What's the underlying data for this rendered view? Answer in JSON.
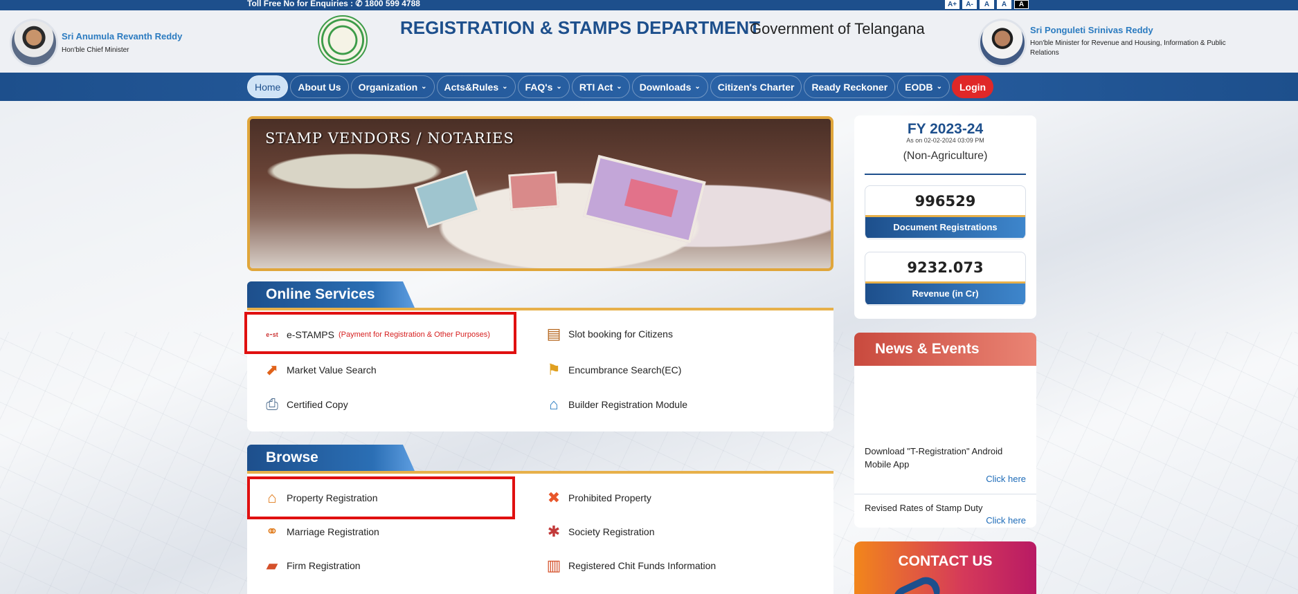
{
  "topbar": {
    "toll_free": "Toll Free No for Enquiries :  ✆ 1800 599 4788",
    "font_buttons": [
      "A+",
      "A-",
      "A",
      "A",
      "A"
    ]
  },
  "header": {
    "chief_minister": {
      "name": "Sri Anumula Revanth Reddy",
      "role": "Hon'ble Chief Minister"
    },
    "department": "REGISTRATION & STAMPS DEPARTMENT",
    "government": "Government of Telangana",
    "minister": {
      "name": "Sri Ponguleti Srinivas Reddy",
      "role": "Hon'ble Minister for Revenue and Housing, Information & Public Relations"
    }
  },
  "nav": {
    "items": [
      {
        "label": "Home",
        "caret": false
      },
      {
        "label": "About Us",
        "caret": false
      },
      {
        "label": "Organization",
        "caret": true
      },
      {
        "label": "Acts&Rules",
        "caret": true
      },
      {
        "label": "FAQ's",
        "caret": true
      },
      {
        "label": "RTI Act",
        "caret": true
      },
      {
        "label": "Downloads",
        "caret": true
      },
      {
        "label": "Citizen's Charter",
        "caret": false
      },
      {
        "label": "Ready Reckoner",
        "caret": false
      },
      {
        "label": "EODB",
        "caret": true
      },
      {
        "label": "Login",
        "caret": false
      }
    ]
  },
  "banner": {
    "caption": "STAMP VENDORS / NOTARIES"
  },
  "online_services": {
    "title": "Online Services",
    "items": [
      {
        "label": "e-STAMPS",
        "note": "(Payment for Registration & Other Purposes)",
        "icon": "estamps-logo-icon"
      },
      {
        "label": "Slot booking for Citizens",
        "icon": "slot-booking-icon"
      },
      {
        "label": "Market Value Search",
        "icon": "chart-up-icon"
      },
      {
        "label": "Encumbrance Search(EC)",
        "icon": "ec-search-icon"
      },
      {
        "label": "Certified Copy",
        "icon": "certified-copy-icon"
      },
      {
        "label": "Builder Registration Module",
        "icon": "building-icon"
      }
    ]
  },
  "browse": {
    "title": "Browse",
    "items": [
      {
        "label": "Property Registration",
        "icon": "house-icon"
      },
      {
        "label": "Prohibited Property",
        "icon": "prohibited-icon"
      },
      {
        "label": "Marriage Registration",
        "icon": "couple-icon"
      },
      {
        "label": "Society Registration",
        "icon": "society-icon"
      },
      {
        "label": "Firm Registration",
        "icon": "firm-icon"
      },
      {
        "label": "Registered Chit Funds Information",
        "icon": "chit-funds-icon"
      }
    ]
  },
  "stats": {
    "fy": "FY 2023-24",
    "as_on": "As on 02-02-2024 03:09 PM",
    "type": "(Non-Agriculture)",
    "documents": {
      "value": "996529",
      "label": "Document Registrations"
    },
    "revenue": {
      "value": "9232.073",
      "label": "Revenue (in Cr)"
    }
  },
  "news": {
    "title": "News & Events",
    "items": [
      {
        "text": "Download \"T-Registration\" Android Mobile App",
        "link": "Click here"
      },
      {
        "text": "Revised Rates of Stamp Duty",
        "link": "Click here"
      }
    ]
  },
  "contact": {
    "title": "CONTACT US"
  },
  "colors": {
    "primary": "#1d4f8c",
    "accent": "#e7b04a",
    "highlight": "#e01010",
    "login": "#e02828"
  }
}
